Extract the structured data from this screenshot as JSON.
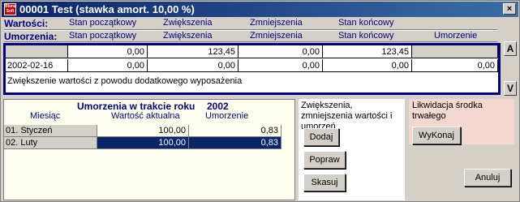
{
  "window": {
    "title": "00001 Test (stawka amort. 10,00 %)",
    "app_icon_text": "Biura Soft",
    "close_label": "×"
  },
  "header": {
    "row1_label": "Wartości:",
    "row2_label": "Umorzenia:",
    "row1_cols": [
      "Stan początkowy",
      "Zwiększenia",
      "Zmniejszenia",
      "Stan końcowy"
    ],
    "row2_cols": [
      "Stan początkowy",
      "Zwiększenia",
      "Zmniejszenia",
      "Stan końcowy",
      "Umorzenie"
    ]
  },
  "scroll": {
    "up": "A",
    "down": "V"
  },
  "grid": {
    "row1": [
      "",
      "0,00",
      "123,45",
      "0,00",
      "123,45",
      ""
    ],
    "row2": [
      "2002-02-16",
      "0,00",
      "0,00",
      "0,00",
      "0,00",
      "0,00"
    ],
    "note": "Zwiększenie wartości z powodu dodatkowego wyposażenia"
  },
  "lower": {
    "title": "Umorzenia w trakcie roku",
    "year": "2002",
    "col_month": "Miesiąc",
    "col_value": "Wartość aktualna",
    "col_amort": "Umorzenie",
    "rows": [
      {
        "month": "01. Styczeń",
        "value": "100,00",
        "amort": "0,83"
      },
      {
        "month": "02. Luty",
        "value": "100,00",
        "amort": "0,83"
      }
    ],
    "selected_index": 1
  },
  "middle": {
    "header": "Zwiększenia, zmniejszenia wartości i umorzeń",
    "add": "Dodaj",
    "edit": "Popraw",
    "delete": "Skasuj"
  },
  "right": {
    "header": "Likwidacja środka trwałego",
    "execute": "WyKonaj",
    "cancel": "Anuluj"
  },
  "colors": {
    "title_bar": "#0a246a",
    "header_text": "#000080",
    "grid_border": "#000080",
    "selection": "#0a246a",
    "lower_panel_bg": "#fffff0",
    "right_panel_bg": "#f4d8d0"
  }
}
